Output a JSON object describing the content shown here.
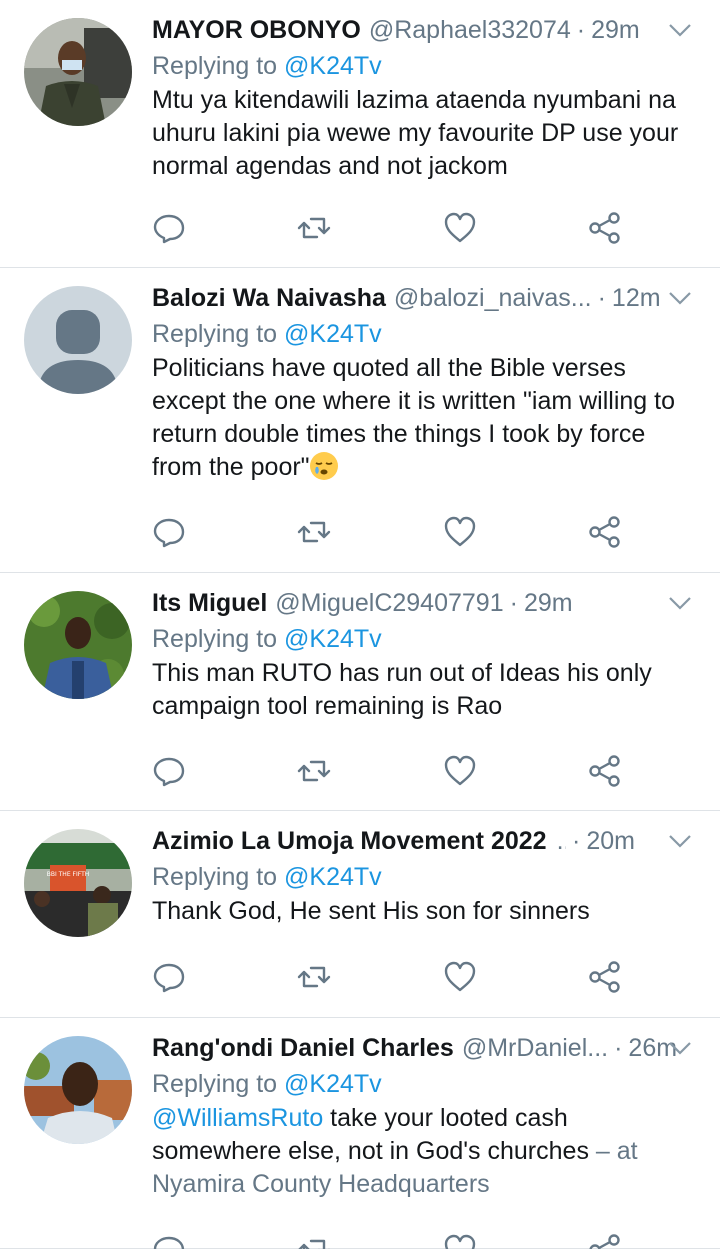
{
  "feed": {
    "tweets": [
      {
        "name": "MAYOR OBONYO",
        "handle": "@Raphael332074",
        "separator": "·",
        "time": "29m",
        "replying_label": "Replying to",
        "replying_to": "@K24Tv",
        "text": "Mtu ya kitendawili lazima ataenda nyumbani na\nuhuru lakini pia wewe my favourite DP use your\nnormal agendas and not jackom"
      },
      {
        "name": "Balozi Wa Naivasha",
        "handle": "@balozi_naivas...",
        "separator": "·",
        "time": "12m",
        "replying_label": "Replying to",
        "replying_to": "@K24Tv",
        "text": "Politicians have quoted all the Bible verses\nexcept the one where it is written \"iam willing to\nreturn double times the things I took by force\nfrom the poor\"",
        "emoji": "sleepy-face-emoji"
      },
      {
        "name": "Its Miguel",
        "handle": "@MiguelC29407791",
        "separator": "·",
        "time": "29m",
        "replying_label": "Replying to",
        "replying_to": "@K24Tv",
        "text": "This man RUTO has run out of Ideas his only\ncampaign tool remaining is Rao"
      },
      {
        "name": "Azimio La Umoja Movement 2022",
        "handle": "...",
        "separator": "·",
        "time": "20m",
        "replying_label": "Replying to",
        "replying_to": "@K24Tv",
        "text": "Thank God, He sent His son for sinners",
        "avatar_sign": "BBI THE FIFTH"
      },
      {
        "name": "Rang'ondi Daniel Charles",
        "handle": "@MrDaniel...",
        "separator": "·",
        "time": "26m",
        "replying_label": "Replying to",
        "replying_to": "@K24Tv",
        "text_link": "@WilliamsRuto",
        "text": " take your looted cash\nsomewhere else, not in God's churches ",
        "location": "– at\nNyamira County Headquarters"
      }
    ]
  },
  "icons": [
    "reply-icon",
    "retweet-icon",
    "like-icon",
    "share-icon",
    "caret-down-icon"
  ],
  "colors": {
    "text": "#14171a",
    "secondary": "#657786",
    "link": "#1b95e0",
    "divider": "#dfe3e7"
  }
}
